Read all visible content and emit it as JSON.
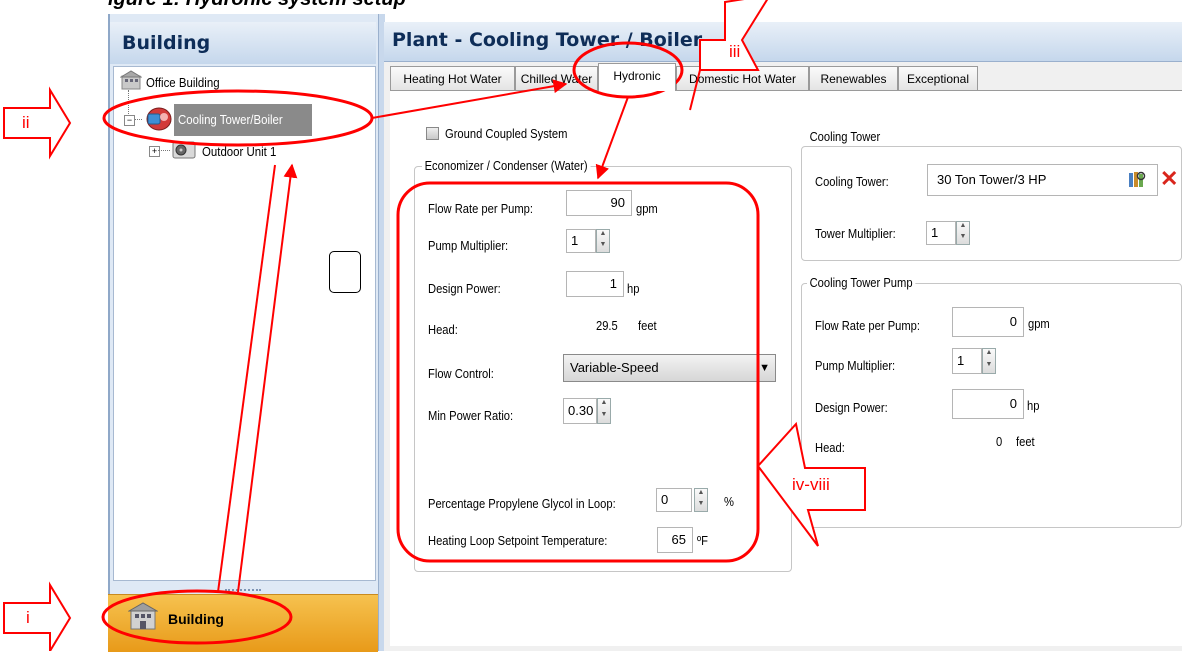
{
  "figure_caption": "igure 1: Hydronic system setup",
  "left_panel": {
    "header": "Building",
    "tree": [
      {
        "label": "Office Building",
        "icon": "building-icon"
      },
      {
        "label": "Cooling Tower/Boiler",
        "icon": "cooling-tower-icon",
        "selected": true
      },
      {
        "label": "Outdoor Unit 1",
        "icon": "outdoor-unit-icon"
      }
    ],
    "bottom_button": "Building"
  },
  "right_panel": {
    "header": "Plant - Cooling Tower / Boiler",
    "tabs": [
      "Heating Hot Water",
      "Chilled Water",
      "Hydronic",
      "Domestic Hot Water",
      "Renewables",
      "Exceptional"
    ],
    "active_tab": "Hydronic"
  },
  "hydronic": {
    "ground_coupled": {
      "label": "Ground Coupled System",
      "checked": false
    },
    "economizer": {
      "title": "Economizer / Condenser (Water)",
      "flow_rate_label": "Flow Rate per Pump:",
      "flow_rate_value": "90",
      "flow_rate_unit": "gpm",
      "pump_multiplier_label": "Pump Multiplier:",
      "pump_multiplier_value": "1",
      "design_power_label": "Design Power:",
      "design_power_value": "1",
      "design_power_unit": "hp",
      "head_label": "Head:",
      "head_value": "29.5",
      "head_unit": "feet",
      "flow_control_label": "Flow Control:",
      "flow_control_value": "Variable-Speed",
      "min_power_ratio_label": "Min Power Ratio:",
      "min_power_ratio_value": "0.30",
      "glycol_label": "Percentage Propylene Glycol in Loop:",
      "glycol_value": "0",
      "glycol_unit": "%",
      "setpoint_label": "Heating Loop Setpoint Temperature:",
      "setpoint_value": "65",
      "setpoint_unit": "ºF"
    },
    "cooling_tower": {
      "title": "Cooling Tower",
      "tower_label": "Cooling Tower:",
      "tower_value": "30 Ton Tower/3 HP",
      "multiplier_label": "Tower Multiplier:",
      "multiplier_value": "1"
    },
    "cooling_tower_pump": {
      "title": "Cooling Tower Pump",
      "flow_rate_label": "Flow Rate per Pump:",
      "flow_rate_value": "0",
      "flow_rate_unit": "gpm",
      "pump_multiplier_label": "Pump Multiplier:",
      "pump_multiplier_value": "1",
      "design_power_label": "Design Power:",
      "design_power_value": "0",
      "design_power_unit": "hp",
      "head_label": "Head:",
      "head_value": "0",
      "head_unit": "feet"
    }
  },
  "annotations": {
    "labels": [
      "i",
      "ii",
      "iii",
      "iv-viii"
    ],
    "color": "#ff0000"
  }
}
